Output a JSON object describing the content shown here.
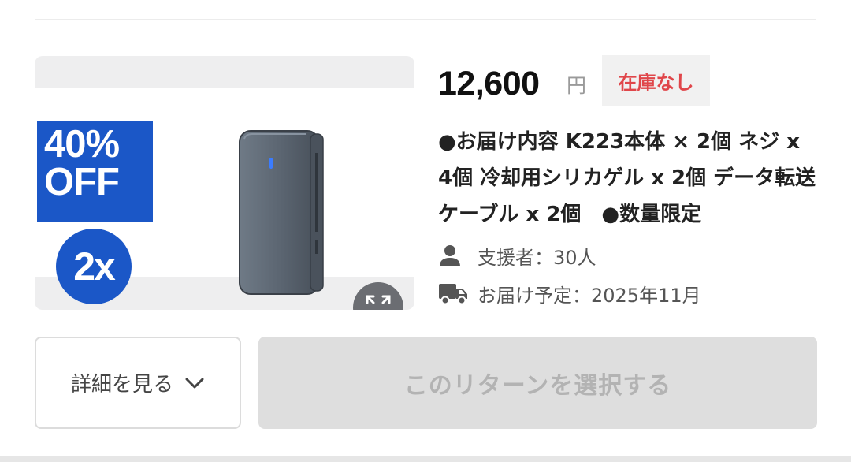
{
  "product": {
    "promo_line1": "40%",
    "promo_line2": "OFF",
    "quantity_badge": "2x",
    "price": "12,600",
    "currency": "円",
    "stock_status": "在庫なし",
    "description": "●お届け内容 K223本体 × 2個 ネジ x 4個 冷却用シリカゲル x 2個 データ転送ケーブル x 2個　●数量限定",
    "supporters_label": "支援者：30人",
    "delivery_label": "お届け予定：2025年11月"
  },
  "actions": {
    "details_label": "詳細を見る",
    "select_label": "このリターンを選択する"
  },
  "icons": {
    "expand": "expand-icon",
    "person": "person-icon",
    "truck": "truck-icon",
    "chevron": "chevron-down-icon"
  },
  "colors": {
    "promo_blue": "#1b57c7",
    "out_of_stock_red": "#e0464a",
    "disabled_button": "#dedede"
  }
}
